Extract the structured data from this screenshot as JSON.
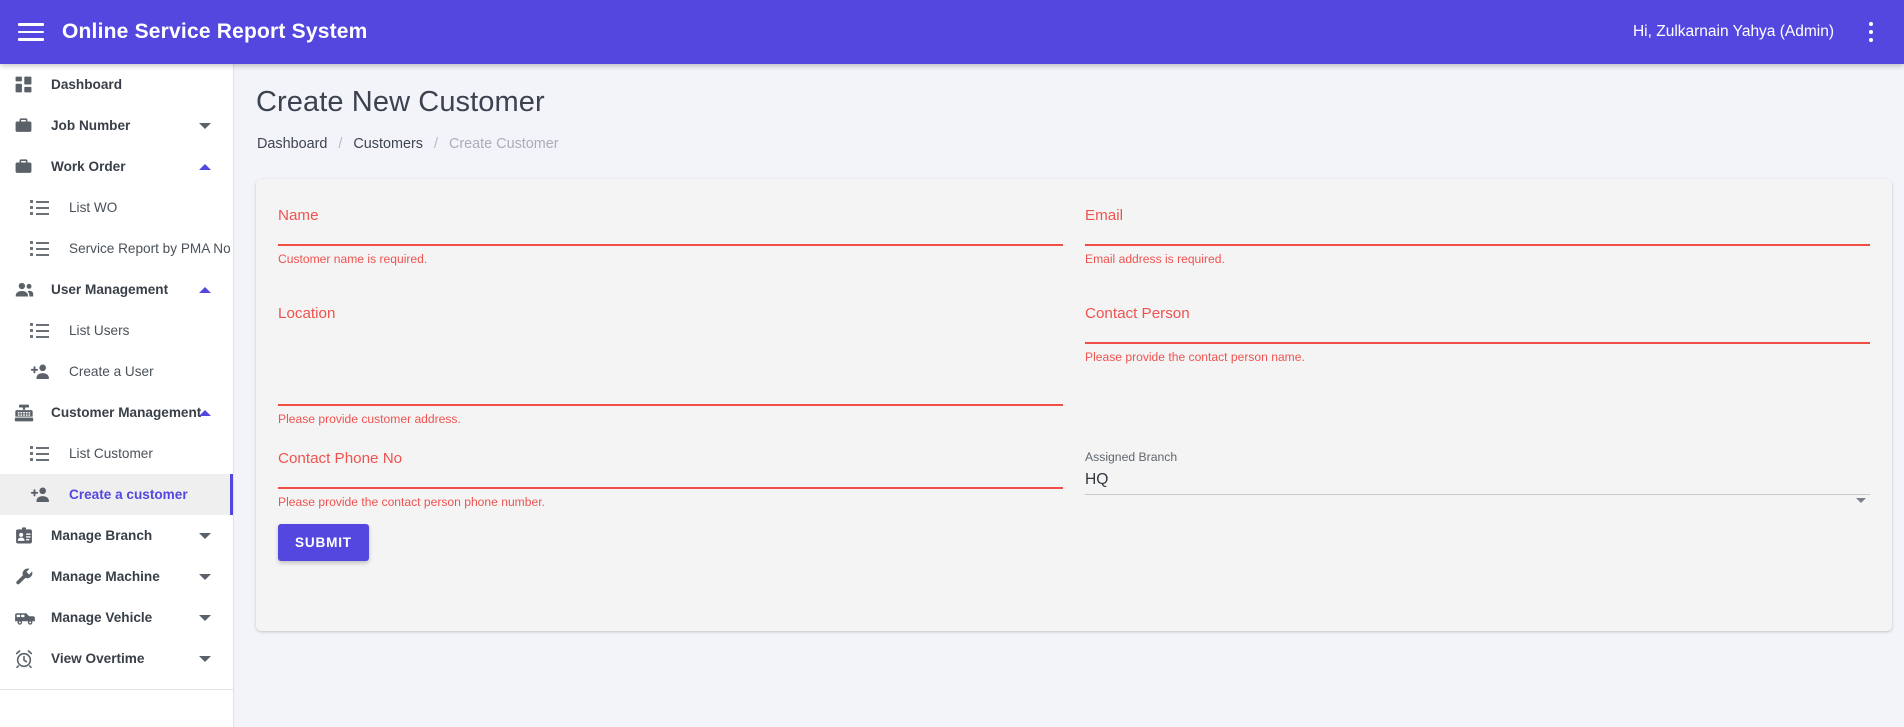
{
  "appbar": {
    "menu_icon": "hamburger-menu-icon",
    "title": "Online Service Report System",
    "user_greeting": "Hi, Zulkarnain Yahya (Admin)",
    "overflow_icon": "kebab-menu-icon",
    "background_color": "#5447e0"
  },
  "sidebar": {
    "items": [
      {
        "label": "Dashboard",
        "icon": "dashboard-grid-icon",
        "level": "parent",
        "expander": "none",
        "active": false
      },
      {
        "label": "Job Number",
        "icon": "briefcase-icon",
        "level": "parent",
        "expander": "down",
        "active": false
      },
      {
        "label": "Work Order",
        "icon": "briefcase-icon",
        "level": "parent",
        "expander": "up",
        "active": false
      },
      {
        "label": "List WO",
        "icon": "list-bullet-icon",
        "level": "sub",
        "expander": "none",
        "active": false
      },
      {
        "label": "Service Report by PMA No",
        "icon": "list-bullet-icon",
        "level": "sub",
        "expander": "none",
        "active": false
      },
      {
        "label": "User Management",
        "icon": "people-icon",
        "level": "parent",
        "expander": "up",
        "active": false
      },
      {
        "label": "List Users",
        "icon": "list-bullet-icon",
        "level": "sub",
        "expander": "none",
        "active": false
      },
      {
        "label": "Create a User",
        "icon": "person-add-icon",
        "level": "sub",
        "expander": "none",
        "active": false
      },
      {
        "label": "Customer Management",
        "icon": "cash-register-icon",
        "level": "parent",
        "expander": "up",
        "active": false
      },
      {
        "label": "List Customer",
        "icon": "list-bullet-icon",
        "level": "sub",
        "expander": "none",
        "active": false
      },
      {
        "label": "Create a customer",
        "icon": "person-add-icon",
        "level": "sub",
        "expander": "none",
        "active": true
      },
      {
        "label": "Manage Branch",
        "icon": "badge-id-icon",
        "level": "parent",
        "expander": "down",
        "active": false
      },
      {
        "label": "Manage Machine",
        "icon": "wrench-icon",
        "level": "parent",
        "expander": "down",
        "active": false
      },
      {
        "label": "Manage Vehicle",
        "icon": "van-icon",
        "level": "parent",
        "expander": "down",
        "active": false
      },
      {
        "label": "View Overtime",
        "icon": "alarm-clock-icon",
        "level": "parent",
        "expander": "down",
        "active": false
      }
    ],
    "active_accent_color": "#5447e0"
  },
  "main": {
    "page_title": "Create New Customer",
    "breadcrumb": [
      {
        "label": "Dashboard",
        "current": false
      },
      {
        "label": "Customers",
        "current": false
      },
      {
        "label": "Create Customer",
        "current": true
      }
    ],
    "breadcrumb_separator": "/"
  },
  "form": {
    "error_color": "#ef5350",
    "fields": {
      "name": {
        "label": "Name",
        "value": "",
        "error": "Customer name is required.",
        "invalid": true
      },
      "email": {
        "label": "Email",
        "value": "",
        "error": "Email address is required.",
        "invalid": true
      },
      "location": {
        "label": "Location",
        "value": "",
        "error": "Please provide customer address.",
        "invalid": true
      },
      "contact_person": {
        "label": "Contact Person",
        "value": "",
        "error": "Please provide the contact person name.",
        "invalid": true
      },
      "contact_phone": {
        "label": "Contact Phone No",
        "value": "",
        "error": "Please provide the contact person phone number.",
        "invalid": true
      },
      "assigned_branch": {
        "label": "Assigned Branch",
        "value": "HQ",
        "error": "",
        "invalid": false
      }
    },
    "submit_label": "SUBMIT",
    "submit_color": "#5447e0"
  }
}
